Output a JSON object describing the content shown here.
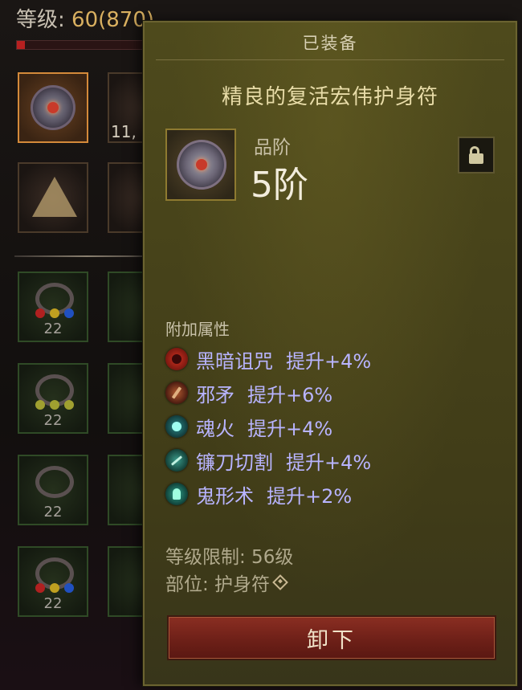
{
  "character": {
    "level_prefix": "等级: ",
    "level_value": "60(870)",
    "count_partial": "11,"
  },
  "inventory": {
    "slot_numbers": [
      "22",
      "22",
      "22",
      "22"
    ]
  },
  "tooltip": {
    "header": "已装备",
    "item_name": "精良的复活宏伟护身符",
    "grade_label": "品阶",
    "grade_value": "5阶",
    "lock_icon": "unlock-icon",
    "attributes_title": "附加属性",
    "attributes": [
      {
        "name": "黑暗诅咒",
        "value": "提升+4%",
        "icon": "dark-curse-icon"
      },
      {
        "name": "邪矛",
        "value": "提升+6%",
        "icon": "evil-spear-icon"
      },
      {
        "name": "魂火",
        "value": "提升+4%",
        "icon": "soul-fire-icon"
      },
      {
        "name": "镰刀切割",
        "value": "提升+4%",
        "icon": "scythe-cut-icon"
      },
      {
        "name": "鬼形术",
        "value": "提升+2%",
        "icon": "ghost-form-icon"
      }
    ],
    "requirement": "等级限制: 56级",
    "slot_label": "部位: 护身符",
    "unequip_label": "卸下"
  },
  "colors": {
    "attribute_text": "#b8b4ff",
    "panel_bg": "#47431a",
    "button_red": "#6e2018",
    "level_accent": "#d9b060"
  }
}
